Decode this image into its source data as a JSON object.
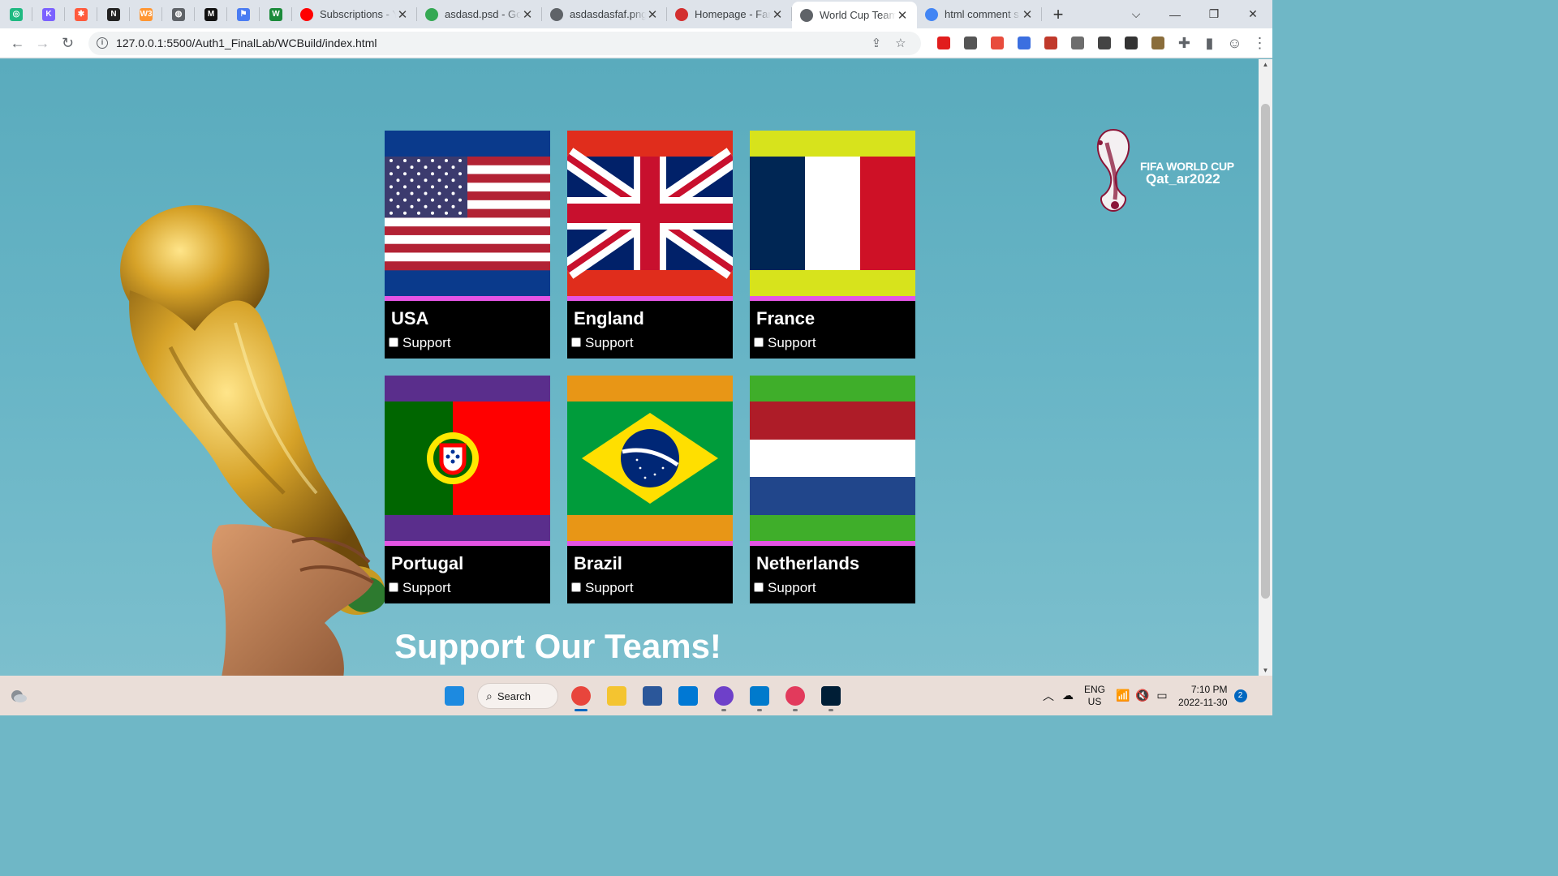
{
  "browser": {
    "pinned_tabs": [
      {
        "icon": "green-app-icon",
        "color": "#1fb981",
        "glyph": "◎"
      },
      {
        "icon": "framer-icon",
        "color": "#7b61ff",
        "glyph": "K"
      },
      {
        "icon": "asterisk-icon",
        "color": "#ff5a3c",
        "glyph": "✱"
      },
      {
        "icon": "nu-icon",
        "color": "#222222",
        "glyph": "N"
      },
      {
        "icon": "w3schools-icon",
        "color": "#ff9632",
        "glyph": "W3"
      },
      {
        "icon": "globe-icon",
        "color": "#5f6368",
        "glyph": "◍"
      },
      {
        "icon": "medium-icon",
        "color": "#111111",
        "glyph": "M"
      },
      {
        "icon": "flag-icon",
        "color": "#4a7cf2",
        "glyph": "⚑"
      },
      {
        "icon": "webflow-w-icon",
        "color": "#1b8a3a",
        "glyph": "W"
      }
    ],
    "tabs": [
      {
        "title": "Subscriptions - Y",
        "icon": "youtube-icon",
        "color": "#ff0000",
        "active": false
      },
      {
        "title": "asdasd.psd - Go",
        "icon": "google-drive-icon",
        "color": "#34a853",
        "active": false
      },
      {
        "title": "asdasdasfaf.png",
        "icon": "globe-icon",
        "color": "#5f6368",
        "active": false
      },
      {
        "title": "Homepage - Far",
        "icon": "fu-icon",
        "color": "#d32f2f",
        "active": false
      },
      {
        "title": "World Cup Team",
        "icon": "globe-icon",
        "color": "#5f6368",
        "active": true
      },
      {
        "title": "html comment s",
        "icon": "google-icon",
        "color": "#4285f4",
        "active": false
      }
    ],
    "new_tab_label": "+",
    "url": "127.0.0.1:5500/Auth1_FinalLab/WCBuild/index.html",
    "extensions": [
      "#e11d1d",
      "#555555",
      "#e84c3d",
      "#3b6fe0",
      "#c0392b",
      "#6d6d6d",
      "#444444",
      "#333333",
      "#8a6d3b"
    ]
  },
  "page": {
    "logo": {
      "line1": "FIFA WORLD CUP",
      "line2": "Qat_ar2022"
    },
    "headline": "Support Our Teams!",
    "support_label": "Support",
    "teams": [
      {
        "name": "USA",
        "flag": "usa",
        "border_color": "#0a3a8c"
      },
      {
        "name": "England",
        "flag": "england",
        "border_color": "#e02d1c"
      },
      {
        "name": "France",
        "flag": "france",
        "border_color": "#d7e31c"
      },
      {
        "name": "Portugal",
        "flag": "portugal",
        "border_color": "#5a2e8c"
      },
      {
        "name": "Brazil",
        "flag": "brazil",
        "border_color": "#e89616"
      },
      {
        "name": "Netherlands",
        "flag": "netherlands",
        "border_color": "#3fae2a"
      }
    ],
    "accent_bar_color": "#e454e4"
  },
  "taskbar": {
    "search_label": "Search",
    "apps": [
      {
        "name": "windows-start",
        "color": "#1d8ae0",
        "running": false
      },
      {
        "name": "chrome",
        "color": "#e8453c",
        "running": true,
        "active": true
      },
      {
        "name": "file-explorer",
        "color": "#f4c430",
        "running": false
      },
      {
        "name": "word",
        "color": "#2b579a",
        "running": false
      },
      {
        "name": "store",
        "color": "#0078d4",
        "running": false
      },
      {
        "name": "github-desktop",
        "color": "#6e40c9",
        "running": true
      },
      {
        "name": "vscode",
        "color": "#007acc",
        "running": true
      },
      {
        "name": "creative-cloud",
        "color": "#e23a5c",
        "running": true
      },
      {
        "name": "photoshop",
        "color": "#001e36",
        "running": true
      }
    ],
    "lang_line1": "ENG",
    "lang_line2": "US",
    "time": "7:10 PM",
    "date": "2022-11-30",
    "notifications": "2"
  }
}
